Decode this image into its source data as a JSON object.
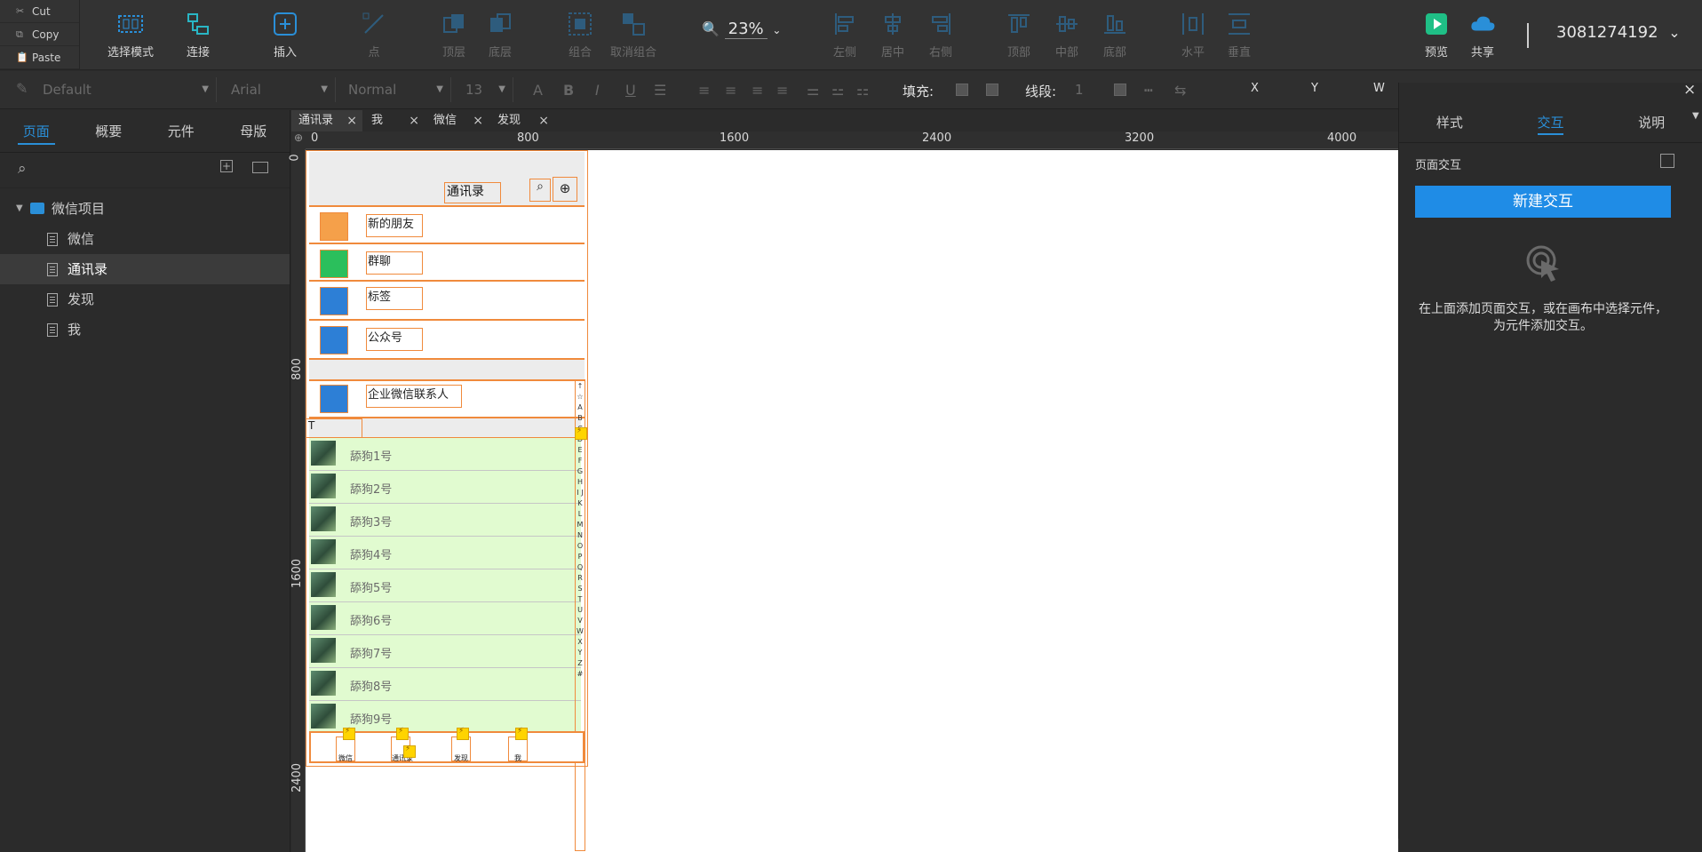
{
  "clipboard": {
    "cut": "Cut",
    "copy": "Copy",
    "paste": "Paste"
  },
  "toolbar": {
    "select_mode": "选择模式",
    "connect": "连接",
    "insert": "插入",
    "point": "点",
    "top_layer": "顶层",
    "bottom_layer": "底层",
    "group": "组合",
    "ungroup": "取消组合",
    "align_left": "左侧",
    "align_center": "居中",
    "align_right": "右侧",
    "align_top": "顶部",
    "align_middle": "中部",
    "align_bottom": "底部",
    "horizontal": "水平",
    "vertical": "垂直",
    "zoom": "23%",
    "preview": "预览",
    "share": "共享",
    "user": "3081274192"
  },
  "format": {
    "style": "Default",
    "font": "Arial",
    "weight": "Normal",
    "size": "13",
    "fill_label": "填充:",
    "stroke_label": "线段:",
    "stroke_value": "1",
    "x_label": "X",
    "y_label": "Y",
    "w_label": "W"
  },
  "left_panel": {
    "tabs": [
      "页面",
      "概要",
      "元件",
      "母版"
    ],
    "project": "微信项目",
    "pages": [
      "微信",
      "通讯录",
      "发现",
      "我"
    ],
    "selected_page": "通讯录"
  },
  "page_tabs": [
    "通讯录",
    "我",
    "微信",
    "发现"
  ],
  "ruler": {
    "h": [
      "0",
      "800",
      "1600",
      "2400",
      "3200",
      "4000"
    ],
    "v": [
      "0",
      "800",
      "1600",
      "2400"
    ]
  },
  "phone": {
    "title": "通讯录",
    "menu": [
      "新的朋友",
      "群聊",
      "标签",
      "公众号",
      "企业微信联系人"
    ],
    "section_letter": "T",
    "friends": [
      "舔狗1号",
      "舔狗2号",
      "舔狗3号",
      "舔狗4号",
      "舔狗5号",
      "舔狗6号",
      "舔狗7号",
      "舔狗8号",
      "舔狗9号"
    ],
    "index_letters": "↑ ☆ A B C D E F G H I J K L M N O P Q R S T U V W X Y Z #",
    "bottom_nav": [
      "微信",
      "通讯录",
      "发现",
      "我"
    ],
    "colors": {
      "orange": "#f08a3c",
      "green_row": "#e1fbd0",
      "icon_orange": "#f5a04a",
      "icon_green": "#2bbf5c",
      "icon_blue": "#2d7fd6"
    }
  },
  "right_panel": {
    "tabs": [
      "样式",
      "交互",
      "说明"
    ],
    "section": "页面交互",
    "new_button": "新建交互",
    "hint": "在上面添加页面交互，或在画布中选择元件，为元件添加交互。"
  }
}
